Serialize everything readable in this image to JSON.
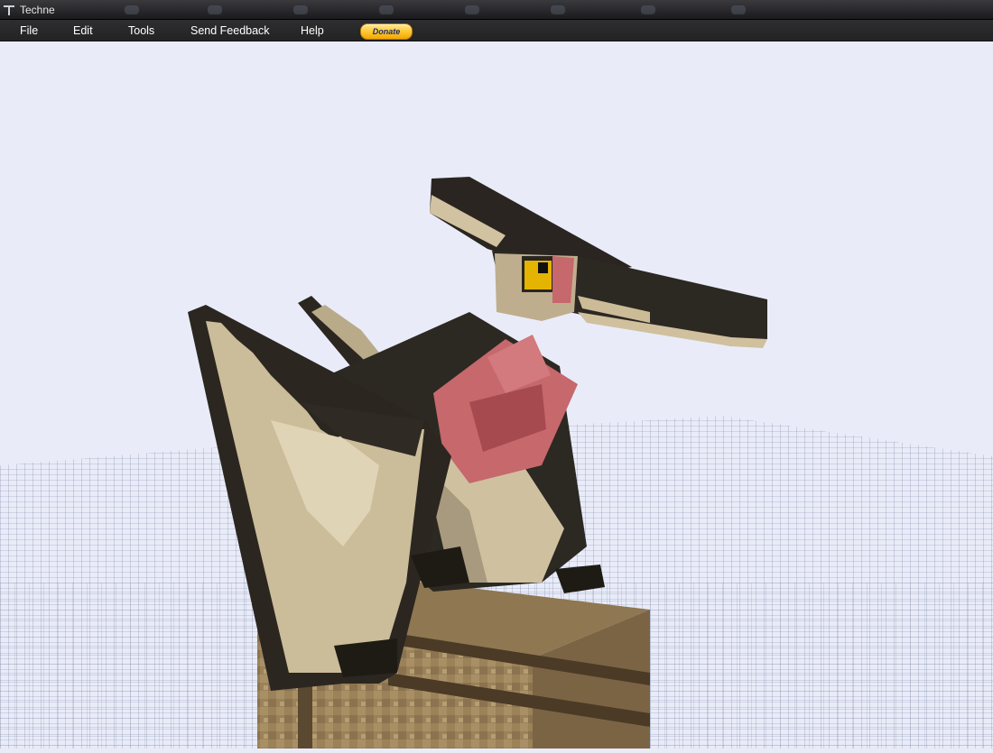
{
  "window": {
    "title": "Techne"
  },
  "menu": {
    "file": "File",
    "edit": "Edit",
    "tools": "Tools",
    "send_feedback": "Send Feedback",
    "help": "Help"
  },
  "donate": {
    "label": "Donate"
  },
  "colors": {
    "viewport_bg": "#e9ecf8",
    "grid": "#7b86a8",
    "wing_dark": "#2a251f",
    "wing_light": "#cdbb98",
    "throat": "#c8666a",
    "eye": "#f0c000",
    "crate": "#9a7e58"
  }
}
